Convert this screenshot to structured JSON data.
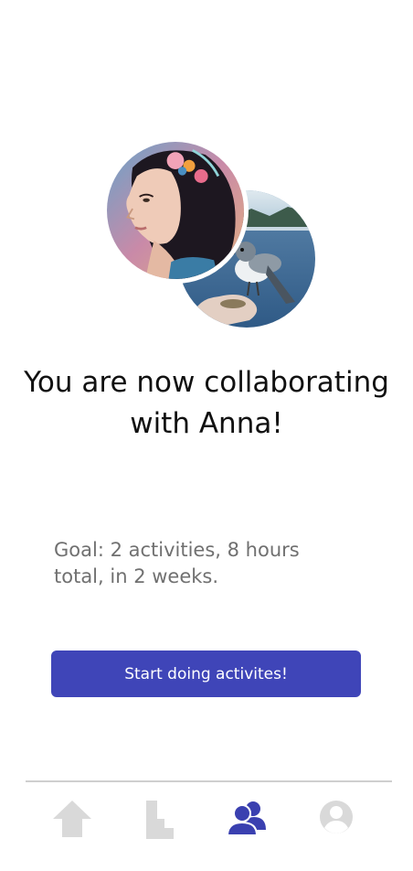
{
  "headline": "You are now collaborating with Anna!",
  "goal_text": "Goal: 2 activities, 8 hours total, in 2 weeks.",
  "primary_button_label": "Start doing activites!",
  "colors": {
    "accent": "#3f45b8",
    "nav_active": "#3a40b0",
    "nav_inactive": "#d9d9d9"
  },
  "avatars": [
    {
      "icon": "woman-portrait-avatar"
    },
    {
      "icon": "bird-photo-avatar"
    }
  ],
  "bottom_nav": [
    {
      "icon": "home-icon",
      "active": false
    },
    {
      "icon": "stats-icon",
      "active": false
    },
    {
      "icon": "collaborators-icon",
      "active": true
    },
    {
      "icon": "profile-icon",
      "active": false
    }
  ]
}
